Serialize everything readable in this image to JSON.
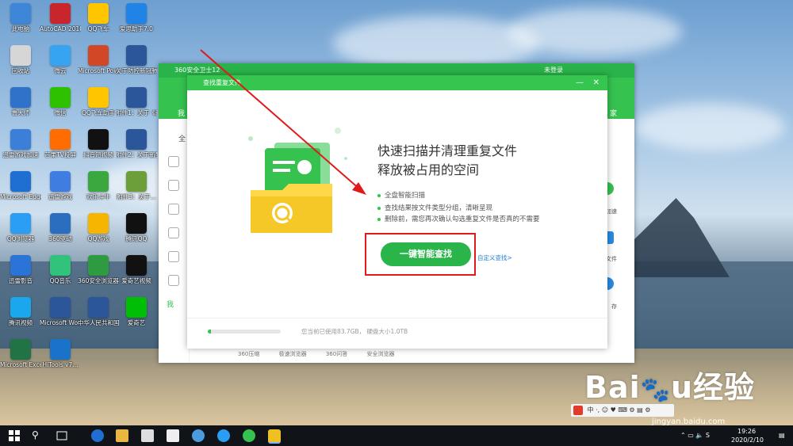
{
  "desktop": {
    "icons": [
      {
        "label": "此电脑",
        "color": "#3e86d8"
      },
      {
        "label": "AutoCAD 2010 - S...",
        "color": "#c8262c"
      },
      {
        "label": "QQ飞车",
        "color": "#ffc600"
      },
      {
        "label": "爱思助手7.0",
        "color": "#1f84e6"
      },
      {
        "label": "回收站",
        "color": "#d6d6d6"
      },
      {
        "label": "微云",
        "color": "#37a4f2"
      },
      {
        "label": "Microsoft PowerPoi...",
        "color": "#d24726"
      },
      {
        "label": "关于防控新冠肺炎疫情...",
        "color": "#2b579a"
      },
      {
        "label": "鲁大师",
        "color": "#2e73c9"
      },
      {
        "label": "微信",
        "color": "#2dc100"
      },
      {
        "label": "QQ飞车助手",
        "color": "#ffc600"
      },
      {
        "label": "附件1：关于《新型冠状...",
        "color": "#2b579a"
      },
      {
        "label": "迅雷游戏加速",
        "color": "#3b7fd8"
      },
      {
        "label": "芒果TV投屏",
        "color": "#ff6c00"
      },
      {
        "label": "抖音短视频",
        "color": "#111111"
      },
      {
        "label": "附件2：关于新型冠状...",
        "color": "#2b579a"
      },
      {
        "label": "Microsoft Edge",
        "color": "#1e6fd1"
      },
      {
        "label": "迅雷游戏",
        "color": "#3f7ee0"
      },
      {
        "label": "欢乐斗牛",
        "color": "#3aa83f"
      },
      {
        "label": "附件3：关于...",
        "color": "#6c9f3a"
      },
      {
        "label": "QQ浏览器",
        "color": "#2a9df4"
      },
      {
        "label": "360驱动",
        "color": "#2a6fbf"
      },
      {
        "label": "QQ游戏",
        "color": "#f6b500"
      },
      {
        "label": "腾讯QQ",
        "color": "#111111"
      },
      {
        "label": "迅雷影音",
        "color": "#2a74d8"
      },
      {
        "label": "QQ音乐",
        "color": "#31c27c"
      },
      {
        "label": "360安全浏览器",
        "color": "#2f9b40"
      },
      {
        "label": "爱奇艺视频",
        "color": "#111111"
      },
      {
        "label": "腾讯视频",
        "color": "#1aa7ec"
      },
      {
        "label": "Microsoft Word 2010",
        "color": "#2b579a"
      },
      {
        "label": "中华人民共和国关于...",
        "color": "#2b579a"
      },
      {
        "label": "爱奇艺",
        "color": "#00be06"
      },
      {
        "label": "Microsoft Excel 2010",
        "color": "#217346"
      },
      {
        "label": "HiTools v7...",
        "color": "#1a73c9"
      }
    ]
  },
  "main_window": {
    "title": "360安全卫士12",
    "login": "未登录",
    "tab_left": "我",
    "tab_right": "家",
    "side_label": "全",
    "side_bottom": "我",
    "right_labels": [
      "加速",
      "文件",
      "存"
    ],
    "bottom_links": [
      "360压缩",
      "极速浏览器",
      "360问答",
      "安全浏览器"
    ]
  },
  "dialog": {
    "title": "查找重复文件",
    "minimize": "—",
    "close": "✕",
    "headline1": "快速扫描并清理重复文件",
    "headline2": "释放被占用的空间",
    "features": [
      "全盘智能扫描",
      "查找结果按文件类型分组，清晰呈现",
      "删除前，需您再次确认勾选重复文件是否真的不需要"
    ],
    "scan_button": "一键智能查找",
    "custom_link": "自定义查找>",
    "disk_info": "您当前已使用83.7GB， 硬盘大小1.0TB",
    "progress_fraction": 0.04
  },
  "taskbar": {
    "time": "19:26",
    "date": "2020/2/10"
  },
  "ime_bar": "中 ·, ☺ ♥ ⌨ ⚙ ▤ ⚙",
  "watermark": {
    "logo": "Bai度经验",
    "url": "jingyan.baidu.com"
  }
}
